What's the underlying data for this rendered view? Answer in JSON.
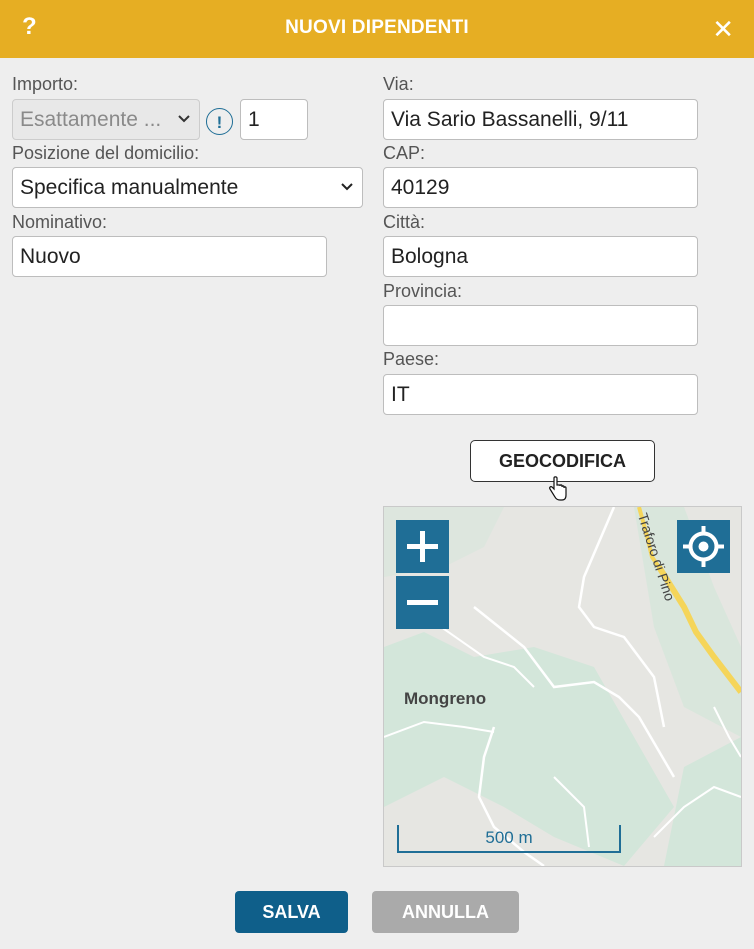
{
  "header": {
    "title": "NUOVI DIPENDENTI",
    "help_label": "?",
    "close_label": "✕"
  },
  "form": {
    "importo": {
      "label": "Importo:",
      "select_value": "Esattamente ...",
      "info_label": "!",
      "quantity": "1"
    },
    "posizione": {
      "label": "Posizione del domicilio:",
      "value": "Specifica manualmente"
    },
    "nominativo": {
      "label": "Nominativo:",
      "value": "Nuovo"
    },
    "via": {
      "label": "Via:",
      "value": "Via Sario Bassanelli, 9/11"
    },
    "cap": {
      "label": "CAP:",
      "value": "40129"
    },
    "citta": {
      "label": "Città:",
      "value": "Bologna"
    },
    "provincia": {
      "label": "Provincia:",
      "value": ""
    },
    "paese": {
      "label": "Paese:",
      "value": "IT"
    },
    "geocode_label": "GEOCODIFICA"
  },
  "map": {
    "place_label": "Mongreno",
    "road_label": "Traforo di Pino",
    "scale_label": "500 m",
    "colors": {
      "land": "#e6e6e2",
      "park": "#d3e6da",
      "road": "#f5d55a",
      "control": "#1f6e96"
    }
  },
  "footer": {
    "save_label": "SALVA",
    "cancel_label": "ANNULLA",
    "colors": {
      "save": "#0f5f8a",
      "cancel": "#aaaaaa"
    }
  }
}
